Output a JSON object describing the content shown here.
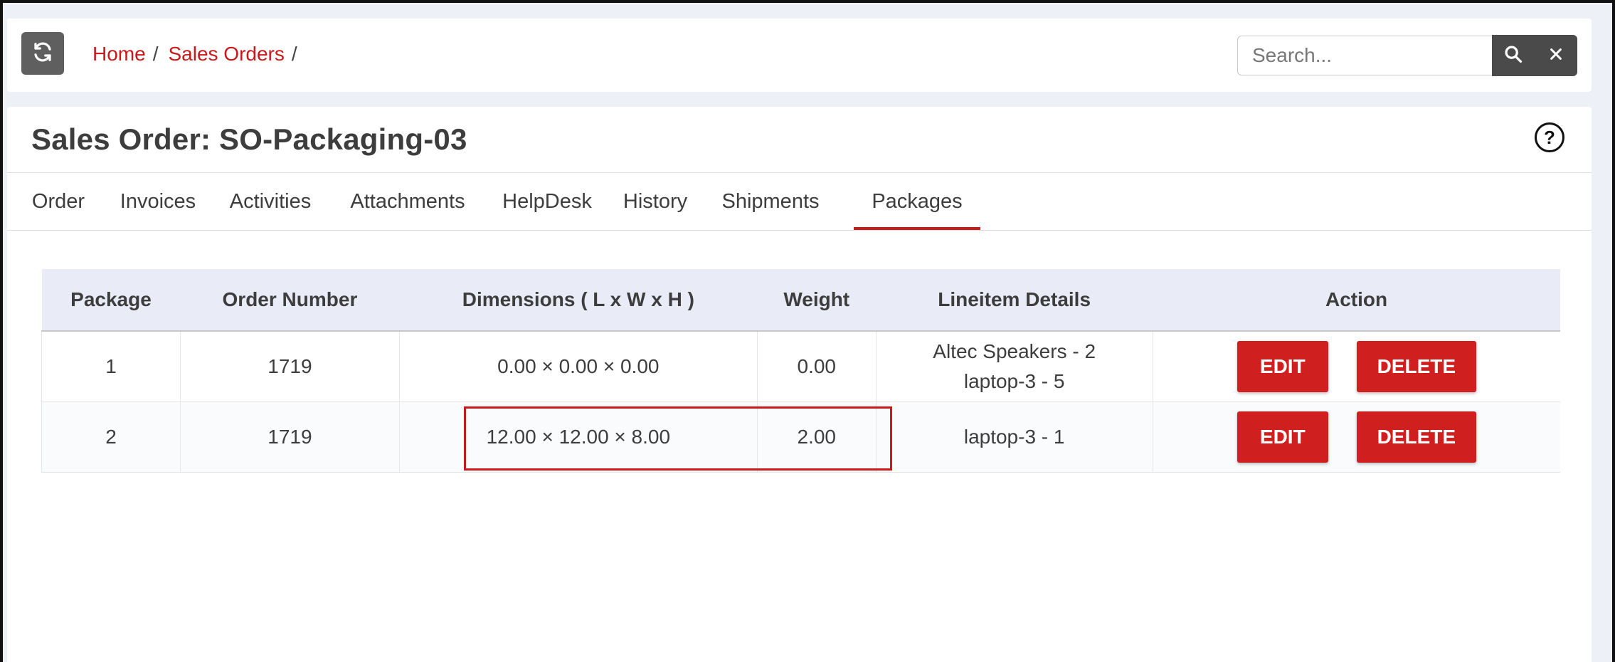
{
  "breadcrumb": {
    "home": "Home",
    "sep1": "/",
    "sales_orders": "Sales Orders",
    "sep2": "/"
  },
  "search": {
    "placeholder": "Search...",
    "value": ""
  },
  "icons": {
    "refresh": "refresh-icon",
    "search": "search-icon",
    "clear": "close-icon",
    "help": "help-icon",
    "help_glyph": "?"
  },
  "page": {
    "title": "Sales Order: SO-Packaging-03"
  },
  "tabs": [
    {
      "label": "Order"
    },
    {
      "label": "Invoices"
    },
    {
      "label": "Activities"
    },
    {
      "label": "Attachments"
    },
    {
      "label": "HelpDesk"
    },
    {
      "label": "History"
    },
    {
      "label": "Shipments"
    },
    {
      "label": "Packages",
      "active": true
    }
  ],
  "table": {
    "headers": [
      "Package",
      "Order Number",
      "Dimensions ( L x W x H )",
      "Weight",
      "Lineitem Details",
      "Action"
    ],
    "rows": [
      {
        "package": "1",
        "order_number": "1719",
        "dimensions": "0.00 × 0.00 × 0.00",
        "weight": "0.00",
        "lineitems": [
          "Altec Speakers - 2",
          "laptop-3 - 5"
        ],
        "edit_label": "EDIT",
        "delete_label": "DELETE"
      },
      {
        "package": "2",
        "order_number": "1719",
        "dimensions": "12.00 × 12.00 × 8.00",
        "weight": "2.00",
        "lineitems": [
          "laptop-3 - 1"
        ],
        "edit_label": "EDIT",
        "delete_label": "DELETE"
      }
    ]
  },
  "colors": {
    "accent": "#c8191b",
    "button": "#d01f1f",
    "header_bg": "#e9ecf7",
    "dark_button": "#4a4a4a"
  }
}
